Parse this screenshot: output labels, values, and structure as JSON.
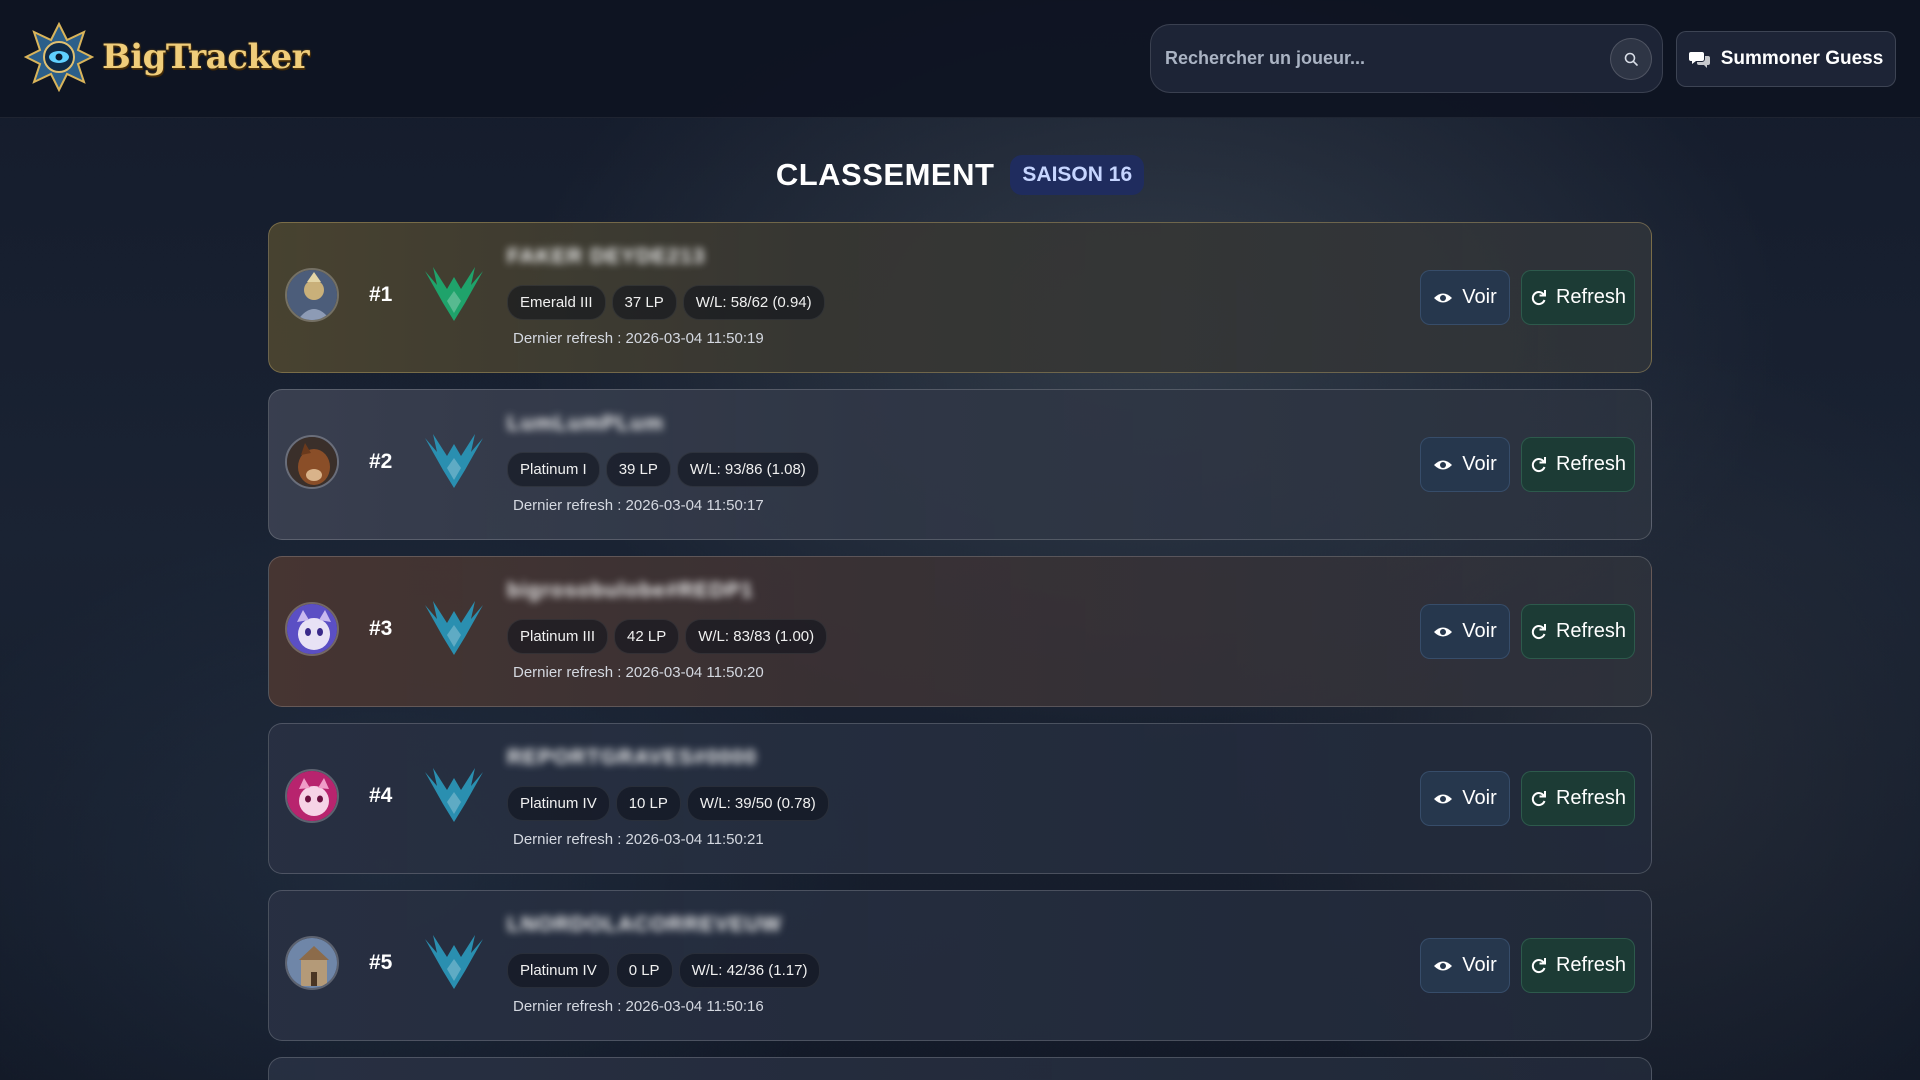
{
  "app": {
    "logo_text": "BigTracker",
    "search_placeholder": "Rechercher un joueur...",
    "guess_label": "Summoner Guess"
  },
  "page": {
    "title": "CLASSEMENT",
    "season": "SAISON 16"
  },
  "buttons": {
    "view_label": "Voir",
    "refresh_label": "Refresh"
  },
  "colors": {
    "emerald": "#1fa36b",
    "platinum": "#2a8fb0"
  },
  "players": [
    {
      "rank": "#1",
      "name": "FAKER DEYDE213",
      "tier": "Emerald III",
      "lp": "37 LP",
      "wl": "W/L: 58/62 (0.94)",
      "refreshed": "Dernier refresh : 2026-03-04 11:50:19",
      "emblem": "emerald-emblem-icon"
    },
    {
      "rank": "#2",
      "name": "LumLumPLum",
      "tier": "Platinum I",
      "lp": "39 LP",
      "wl": "W/L: 93/86 (1.08)",
      "refreshed": "Dernier refresh : 2026-03-04 11:50:17",
      "emblem": "platinum-emblem-icon"
    },
    {
      "rank": "#3",
      "name": "bigrosobulobe#REDP1",
      "tier": "Platinum III",
      "lp": "42 LP",
      "wl": "W/L: 83/83 (1.00)",
      "refreshed": "Dernier refresh : 2026-03-04 11:50:20",
      "emblem": "platinum-emblem-icon"
    },
    {
      "rank": "#4",
      "name": "REPORTGRAVES#0000",
      "tier": "Platinum IV",
      "lp": "10 LP",
      "wl": "W/L: 39/50 (0.78)",
      "refreshed": "Dernier refresh : 2026-03-04 11:50:21",
      "emblem": "platinum-emblem-icon"
    },
    {
      "rank": "#5",
      "name": "LNORDOLACORREVEUW",
      "tier": "Platinum IV",
      "lp": "0 LP",
      "wl": "W/L: 42/36 (1.17)",
      "refreshed": "Dernier refresh : 2026-03-04 11:50:16",
      "emblem": "platinum-emblem-icon"
    }
  ]
}
